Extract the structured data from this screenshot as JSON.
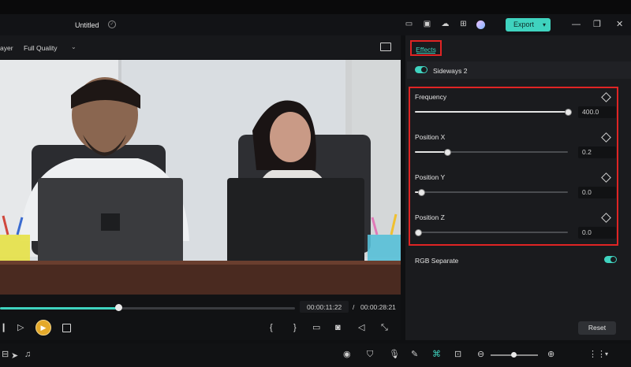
{
  "window": {
    "title": "Untitled"
  },
  "toolbar": {
    "export_label": "Export"
  },
  "player": {
    "view_label_partial": "ayer",
    "quality": "Full Quality",
    "progress_fraction": 0.4,
    "current_time": "00:00:11:22",
    "separator": "/",
    "total_time": "00:00:28:21",
    "controls": [
      "step-back-icon",
      "step-forward-icon",
      "play-icon",
      "stop-icon",
      "mark-in-icon",
      "mark-out-icon",
      "display-icon",
      "snapshot-icon",
      "volume-icon",
      "fullscreen-icon"
    ]
  },
  "panel": {
    "tab": "Effects",
    "effect": {
      "name": "Sideways 2",
      "enabled": true
    },
    "params": [
      {
        "label": "Frequency",
        "value": "400.0",
        "fraction": 1.0
      },
      {
        "label": "Position X",
        "value": "0.2",
        "fraction": 0.21
      },
      {
        "label": "Position Y",
        "value": "0.0",
        "fraction": 0.04
      },
      {
        "label": "Position Z",
        "value": "0.0",
        "fraction": 0.02
      }
    ],
    "rgb_separate": {
      "label": "RGB Separate",
      "enabled": true
    },
    "reset_label": "Reset"
  },
  "colors": {
    "accent": "#3fd3bf",
    "highlight_box": "#e02424",
    "play_button": "#e4a92a"
  }
}
